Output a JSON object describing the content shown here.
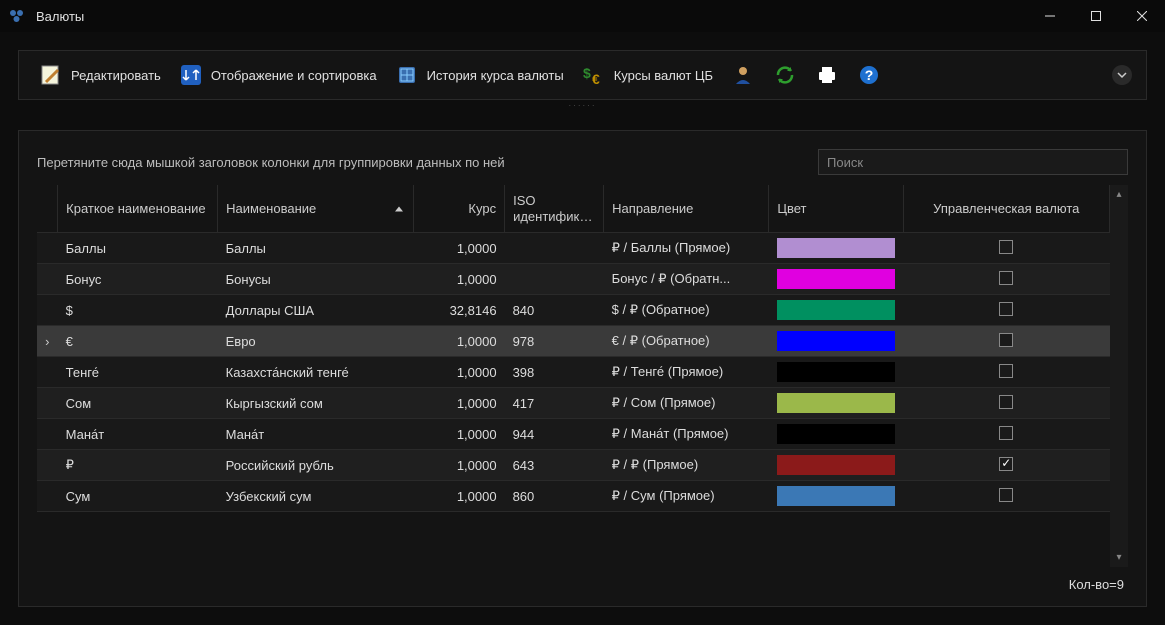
{
  "window": {
    "title": "Валюты"
  },
  "toolbar": {
    "edit": "Редактировать",
    "sort": "Отображение и сортировка",
    "history": "История курса валюты",
    "rates": "Курсы валют ЦБ"
  },
  "grid": {
    "group_hint": "Перетяните сюда мышкой заголовок колонки для группировки данных по ней",
    "search_placeholder": "Поиск",
    "columns": {
      "short": "Краткое наименование",
      "name": "Наименование",
      "rate": "Курс",
      "iso": "ISO идентификатор",
      "direction": "Направление",
      "color": "Цвет",
      "mgmt": "Управленческая валюта"
    },
    "rows": [
      {
        "short": "Баллы",
        "name": "Баллы",
        "rate": "1,0000",
        "iso": "",
        "direction": "₽ / Баллы   (Прямое)",
        "color": "#b18ed1",
        "mgmt": false,
        "selected": false
      },
      {
        "short": "Бонус",
        "name": "Бонусы",
        "rate": "1,0000",
        "iso": "",
        "direction": "Бонус / ₽   (Обратн...",
        "color": "#e000e0",
        "mgmt": false,
        "selected": false
      },
      {
        "short": "$",
        "name": "Доллары США",
        "rate": "32,8146",
        "iso": "840",
        "direction": "$ / ₽   (Обратное)",
        "color": "#009060",
        "mgmt": false,
        "selected": false
      },
      {
        "short": "€",
        "name": "Евро",
        "rate": "1,0000",
        "iso": "978",
        "direction": "€ / ₽   (Обратное)",
        "color": "#0000ff",
        "mgmt": false,
        "selected": true
      },
      {
        "short": "Тенге́",
        "name": "Казахста́нский тенге́",
        "rate": "1,0000",
        "iso": "398",
        "direction": "₽ / Тенге́   (Прямое)",
        "color": "#000000",
        "mgmt": false,
        "selected": false
      },
      {
        "short": "Сом",
        "name": "Кыргызский сом",
        "rate": "1,0000",
        "iso": "417",
        "direction": "₽ / Сом   (Прямое)",
        "color": "#9bb84a",
        "mgmt": false,
        "selected": false
      },
      {
        "short": "Мана́т",
        "name": "Мана́т",
        "rate": "1,0000",
        "iso": "944",
        "direction": "₽ / Мана́т   (Прямое)",
        "color": "#000000",
        "mgmt": false,
        "selected": false
      },
      {
        "short": "₽",
        "name": "Российский рубль",
        "rate": "1,0000",
        "iso": "643",
        "direction": "₽ / ₽   (Прямое)",
        "color": "#8b1a1a",
        "mgmt": true,
        "selected": false
      },
      {
        "short": "Сум",
        "name": "Узбекский сум",
        "rate": "1,0000",
        "iso": "860",
        "direction": "₽ / Сум   (Прямое)",
        "color": "#3b78b5",
        "mgmt": false,
        "selected": false
      }
    ],
    "count_label": "Кол-во=9"
  }
}
